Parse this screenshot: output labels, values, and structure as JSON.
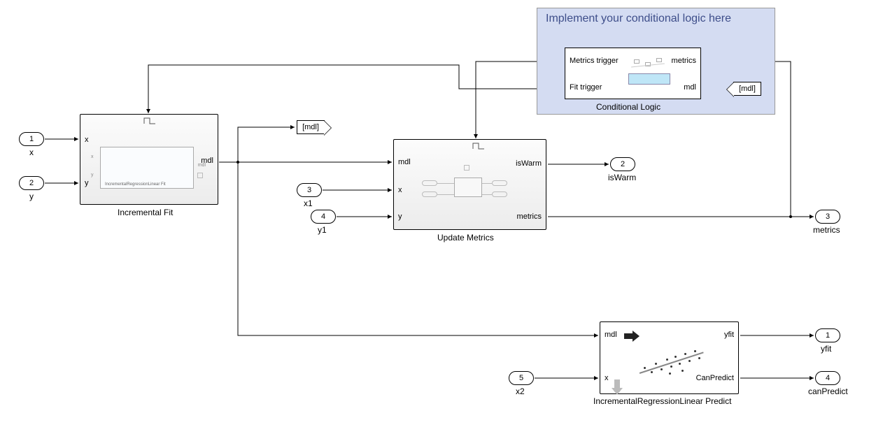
{
  "annotation": {
    "text": "Implement your conditional logic here"
  },
  "conditional_logic": {
    "title": "Conditional Logic",
    "in1": "Metrics trigger",
    "in2": "Fit trigger",
    "out1": "metrics",
    "out2": "mdl"
  },
  "goto_mdl": {
    "tag": "[mdl]"
  },
  "from_mdl": {
    "tag": "[mdl]"
  },
  "inports": {
    "p1": {
      "num": "1",
      "name": "x"
    },
    "p2": {
      "num": "2",
      "name": "y"
    },
    "p3": {
      "num": "3",
      "name": "x1"
    },
    "p4": {
      "num": "4",
      "name": "y1"
    },
    "p5": {
      "num": "5",
      "name": "x2"
    }
  },
  "outports": {
    "o1": {
      "num": "1",
      "name": "yfit"
    },
    "o2": {
      "num": "2",
      "name": "isWarm"
    },
    "o3": {
      "num": "3",
      "name": "metrics"
    },
    "o4": {
      "num": "4",
      "name": "canPredict"
    }
  },
  "incremental_fit": {
    "title": "Incremental Fit",
    "in1": "x",
    "in2": "y",
    "out": "mdl",
    "inner_label": "IncrementalRegressionLinear Fit"
  },
  "update_metrics": {
    "title": "Update Metrics",
    "in1": "mdl",
    "in2": "x",
    "in3": "y",
    "out1": "isWarm",
    "out2": "metrics"
  },
  "predict": {
    "title": "IncrementalRegressionLinear Predict",
    "in1": "mdl",
    "in2": "x",
    "out1": "yfit",
    "out2": "CanPredict"
  }
}
